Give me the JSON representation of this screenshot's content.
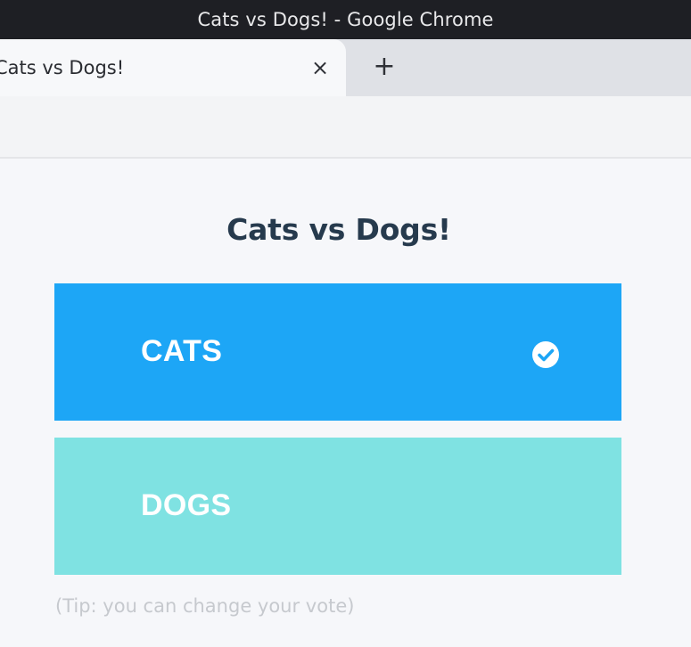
{
  "window": {
    "title": "Cats vs Dogs! - Google Chrome"
  },
  "tab": {
    "title": "Cats vs Dogs!",
    "close_icon": "×",
    "new_tab_icon": "+"
  },
  "page": {
    "title": "Cats vs Dogs!",
    "options": [
      {
        "label": "CATS",
        "selected": true,
        "color": "#1da6f6"
      },
      {
        "label": "DOGS",
        "selected": false,
        "color": "#7fe2e2"
      }
    ],
    "tip": "(Tip: you can change your vote)"
  },
  "icons": {
    "selected": "check-circle-icon"
  }
}
